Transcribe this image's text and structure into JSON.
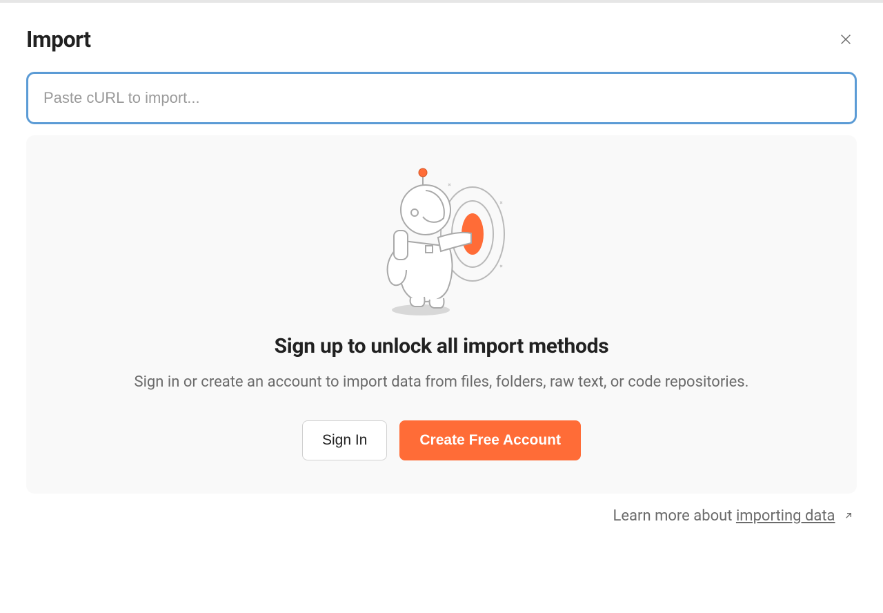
{
  "header": {
    "title": "Import"
  },
  "input": {
    "placeholder": "Paste cURL to import..."
  },
  "promo": {
    "heading": "Sign up to unlock all import methods",
    "body": "Sign in or create an account to import data from files, folders, raw text, or code repositories.",
    "sign_in_label": "Sign In",
    "create_account_label": "Create Free Account"
  },
  "footer": {
    "prefix": "Learn more about ",
    "link_text": "importing data"
  },
  "colors": {
    "accent": "#ff6c37",
    "focus_ring": "#5b9bd5"
  }
}
